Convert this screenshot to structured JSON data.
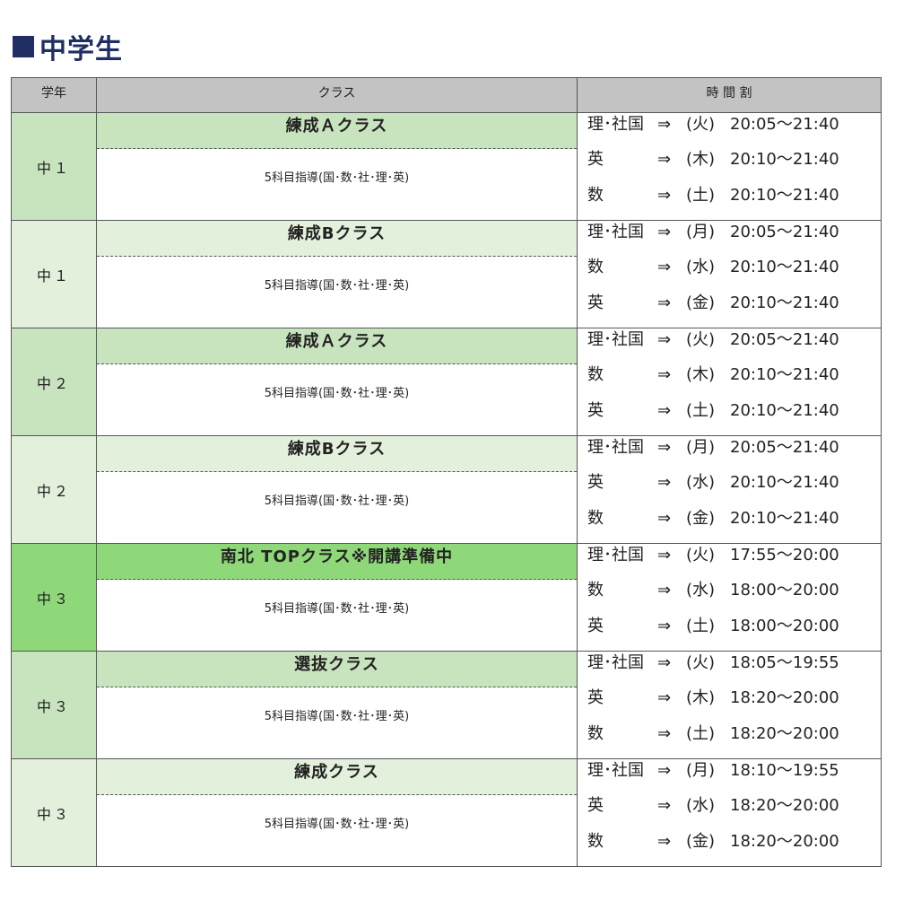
{
  "section": {
    "title": "中学生"
  },
  "table": {
    "headers": {
      "grade": "学年",
      "class": "クラス",
      "timetable": "時 間 割"
    },
    "rows": [
      {
        "grade": "中１",
        "class_name": "練成Ａクラス",
        "subjects": "5科目指導(国･数･社･理･英)",
        "tone": "a",
        "schedule": [
          {
            "subject": "理･社国",
            "arrow": "⇒",
            "day": "(火)",
            "time": "20:05～21:40"
          },
          {
            "subject": "英",
            "arrow": "⇒",
            "day": "(木)",
            "time": "20:10～21:40"
          },
          {
            "subject": "数",
            "arrow": "⇒",
            "day": "(土)",
            "time": "20:10～21:40"
          }
        ]
      },
      {
        "grade": "中１",
        "class_name": "練成Bクラス",
        "subjects": "5科目指導(国･数･社･理･英)",
        "tone": "b",
        "schedule": [
          {
            "subject": "理･社国",
            "arrow": "⇒",
            "day": "(月)",
            "time": "20:05～21:40"
          },
          {
            "subject": "数",
            "arrow": "⇒",
            "day": "(水)",
            "time": "20:10～21:40"
          },
          {
            "subject": "英",
            "arrow": "⇒",
            "day": "(金)",
            "time": "20:10～21:40"
          }
        ]
      },
      {
        "grade": "中２",
        "class_name": "練成Ａクラス",
        "subjects": "5科目指導(国･数･社･理･英)",
        "tone": "a",
        "schedule": [
          {
            "subject": "理･社国",
            "arrow": "⇒",
            "day": "(火)",
            "time": "20:05～21:40"
          },
          {
            "subject": "数",
            "arrow": "⇒",
            "day": "(木)",
            "time": "20:10～21:40"
          },
          {
            "subject": "英",
            "arrow": "⇒",
            "day": "(土)",
            "time": "20:10～21:40"
          }
        ]
      },
      {
        "grade": "中２",
        "class_name": "練成Bクラス",
        "subjects": "5科目指導(国･数･社･理･英)",
        "tone": "b",
        "schedule": [
          {
            "subject": "理･社国",
            "arrow": "⇒",
            "day": "(月)",
            "time": "20:05～21:40"
          },
          {
            "subject": "英",
            "arrow": "⇒",
            "day": "(水)",
            "time": "20:10～21:40"
          },
          {
            "subject": "数",
            "arrow": "⇒",
            "day": "(金)",
            "time": "20:10～21:40"
          }
        ]
      },
      {
        "grade": "中３",
        "class_name": "南北 TOPクラス※開講準備中",
        "subjects": "5科目指導(国･数･社･理･英)",
        "tone": "c",
        "schedule": [
          {
            "subject": "理･社国",
            "arrow": "⇒",
            "day": "(火)",
            "time": "17:55～20:00"
          },
          {
            "subject": "数",
            "arrow": "⇒",
            "day": "(水)",
            "time": "18:00～20:00"
          },
          {
            "subject": "英",
            "arrow": "⇒",
            "day": "(土)",
            "time": "18:00～20:00"
          }
        ]
      },
      {
        "grade": "中３",
        "class_name": "選抜クラス",
        "subjects": "5科目指導(国･数･社･理･英)",
        "tone": "a",
        "schedule": [
          {
            "subject": "理･社国",
            "arrow": "⇒",
            "day": "(火)",
            "time": "18:05～19:55"
          },
          {
            "subject": "英",
            "arrow": "⇒",
            "day": "(木)",
            "time": "18:20～20:00"
          },
          {
            "subject": "数",
            "arrow": "⇒",
            "day": "(土)",
            "time": "18:20～20:00"
          }
        ]
      },
      {
        "grade": "中３",
        "class_name": "練成クラス",
        "subjects": "5科目指導(国･数･社･理･英)",
        "tone": "b",
        "schedule": [
          {
            "subject": "理･社国",
            "arrow": "⇒",
            "day": "(月)",
            "time": "18:10～19:55"
          },
          {
            "subject": "英",
            "arrow": "⇒",
            "day": "(水)",
            "time": "18:20～20:00"
          },
          {
            "subject": "数",
            "arrow": "⇒",
            "day": "(金)",
            "time": "18:20～20:00"
          }
        ]
      }
    ]
  },
  "colors": {
    "heading": "#1f2f63",
    "header_bg": "#c3c3c3",
    "tone_a": "#c8e4be",
    "tone_b": "#e3f1dc",
    "tone_c": "#8ed87a"
  }
}
